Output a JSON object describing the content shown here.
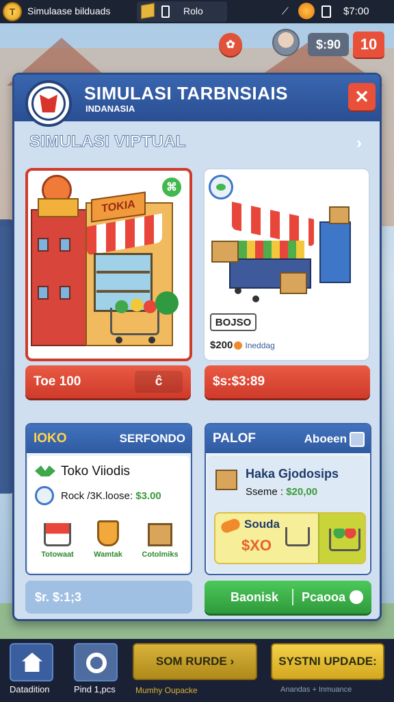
{
  "status_bar": {
    "app_title": "Simulaase bilduads",
    "coin_glyph": "T",
    "mid_label": "Rolo",
    "time": "$7:00"
  },
  "header": {
    "badge_glyph": "✿",
    "money": "$:90",
    "level": "10"
  },
  "dialog": {
    "title": "SIMULASI TARBNSIAIS",
    "subtitle": "INDANASIA",
    "close_glyph": "✕",
    "section_title": "SIMULASI VIPTUAL",
    "section_chevron": "›"
  },
  "cards": [
    {
      "sign": "TOKIA",
      "badge_glyph": "⌘"
    },
    {
      "code": "BOJSO",
      "price": "$200",
      "note": "Ineddag"
    }
  ],
  "price_buttons": [
    {
      "label": "Toe 100",
      "tag": "ĉ"
    },
    {
      "label": "$s:$3:89"
    }
  ],
  "panel_left": {
    "head_left": "IOKO",
    "head_right": "SERFONDO",
    "title": "Toko Viiodis",
    "line_label": "Rock /3K.loose:",
    "line_value": "$3.00",
    "items": [
      {
        "icon": "cart-icon",
        "label": "Totowaat"
      },
      {
        "icon": "cup-icon",
        "label": "Wamtak"
      },
      {
        "icon": "box-icon",
        "label": "Cotolmiks"
      }
    ]
  },
  "panel_right": {
    "head_left": "PALOF",
    "head_right": "Aboeen",
    "title": "Haka Gjodosips",
    "line_label": "Sseme :",
    "line_value": "$20,00",
    "offer_title": "Souda",
    "offer_price": "$XO"
  },
  "bottom": {
    "field_text": "$r. $:1;3",
    "green_left": "Baonisk",
    "green_right": "Pcaooa"
  },
  "nav": {
    "home_label": "Datadition",
    "pin_label": "Pind 1,pcs",
    "gold1_label": "SOM RURDE ›",
    "gold1_sub": "Mumhy Oupacke",
    "gold2_label": "SYSTNI UPDADE:",
    "gold2_sub": "Anandas + Inmuance"
  }
}
